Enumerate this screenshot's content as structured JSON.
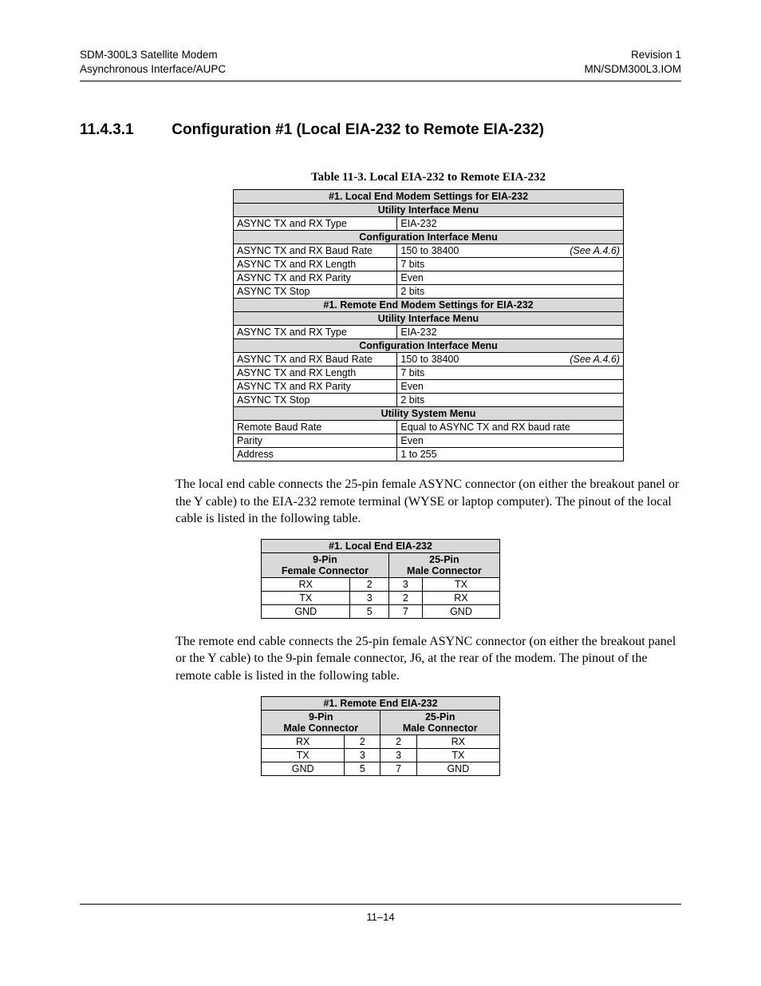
{
  "header": {
    "left1": "SDM-300L3 Satellite Modem",
    "left2": "Asynchronous Interface/AUPC",
    "right1": "Revision 1",
    "right2": "MN/SDM300L3.IOM"
  },
  "section": {
    "number": "11.4.3.1",
    "title": "Configuration #1 (Local EIA-232 to Remote EIA-232)"
  },
  "table_caption": "Table 11-3.  Local EIA-232 to Remote EIA-232",
  "settings": {
    "h1": "#1. Local End Modem Settings for EIA-232",
    "h2": "Utility Interface Menu",
    "r1a": "ASYNC TX and RX Type",
    "r1b": "EIA-232",
    "h3": "Configuration Interface Menu",
    "r2a": "ASYNC TX and RX Baud Rate",
    "r2b": "150 to 38400",
    "r2see": "(See A.4.6)",
    "r3a": "ASYNC TX and RX Length",
    "r3b": "7 bits",
    "r4a": "ASYNC TX and RX Parity",
    "r4b": "Even",
    "r5a": "ASYNC TX Stop",
    "r5b": "2 bits",
    "h4": "#1. Remote End Modem Settings for EIA-232",
    "h5": "Utility Interface Menu",
    "r6a": "ASYNC TX and RX Type",
    "r6b": "EIA-232",
    "h6": "Configuration Interface Menu",
    "r7a": "ASYNC TX and RX Baud Rate",
    "r7b": "150 to 38400",
    "r7see": "(See A.4.6)",
    "r8a": "ASYNC TX and RX Length",
    "r8b": "7 bits",
    "r9a": "ASYNC TX and RX Parity",
    "r9b": "Even",
    "r10a": "ASYNC TX Stop",
    "r10b": "2 bits",
    "h7": "Utility System Menu",
    "r11a": "Remote Baud Rate",
    "r11b": "Equal to ASYNC TX and RX baud rate",
    "r12a": "Parity",
    "r12b": "Even",
    "r13a": "Address",
    "r13b": "1 to 255"
  },
  "para1": "The local end cable connects the 25-pin female ASYNC connector (on either the breakout panel or the Y cable) to the EIA-232 remote terminal (WYSE or laptop computer). The pinout of the local cable is listed in the following table.",
  "pinout1": {
    "title": "#1. Local End EIA-232",
    "h9a": "9-Pin",
    "h9b": "Female Connector",
    "h25a": "25-Pin",
    "h25b": "Male Connector",
    "rows": [
      {
        "a": "RX",
        "b": "2",
        "c": "3",
        "d": "TX"
      },
      {
        "a": "TX",
        "b": "3",
        "c": "2",
        "d": "RX"
      },
      {
        "a": "GND",
        "b": "5",
        "c": "7",
        "d": "GND"
      }
    ]
  },
  "para2": "The remote end cable connects the 25-pin female ASYNC connector (on either the breakout panel or the Y cable) to the 9-pin female connector, J6, at the rear of the modem. The pinout of the remote cable is listed in the following table.",
  "pinout2": {
    "title": "#1. Remote End EIA-232",
    "h9a": "9-Pin",
    "h9b": "Male Connector",
    "h25a": "25-Pin",
    "h25b": "Male Connector",
    "rows": [
      {
        "a": "RX",
        "b": "2",
        "c": "2",
        "d": "RX"
      },
      {
        "a": "TX",
        "b": "3",
        "c": "3",
        "d": "TX"
      },
      {
        "a": "GND",
        "b": "5",
        "c": "7",
        "d": "GND"
      }
    ]
  },
  "footer": "11–14",
  "chart_data": {
    "type": "table",
    "tables": [
      {
        "title": "#1. Local End Modem Settings for EIA-232",
        "sections": [
          {
            "header": "Utility Interface Menu",
            "rows": [
              [
                "ASYNC TX and RX Type",
                "EIA-232"
              ]
            ]
          },
          {
            "header": "Configuration Interface Menu",
            "rows": [
              [
                "ASYNC TX and RX Baud Rate",
                "150 to 38400",
                "(See A.4.6)"
              ],
              [
                "ASYNC TX and RX Length",
                "7 bits"
              ],
              [
                "ASYNC TX and RX Parity",
                "Even"
              ],
              [
                "ASYNC TX Stop",
                "2 bits"
              ]
            ]
          }
        ]
      },
      {
        "title": "#1. Remote End Modem Settings for EIA-232",
        "sections": [
          {
            "header": "Utility Interface Menu",
            "rows": [
              [
                "ASYNC TX and RX Type",
                "EIA-232"
              ]
            ]
          },
          {
            "header": "Configuration Interface Menu",
            "rows": [
              [
                "ASYNC TX and RX Baud Rate",
                "150 to 38400",
                "(See A.4.6)"
              ],
              [
                "ASYNC TX and RX Length",
                "7 bits"
              ],
              [
                "ASYNC TX and RX Parity",
                "Even"
              ],
              [
                "ASYNC TX Stop",
                "2 bits"
              ]
            ]
          },
          {
            "header": "Utility System Menu",
            "rows": [
              [
                "Remote Baud Rate",
                "Equal to ASYNC TX and RX baud rate"
              ],
              [
                "Parity",
                "Even"
              ],
              [
                "Address",
                "1 to 255"
              ]
            ]
          }
        ]
      },
      {
        "title": "#1. Local End EIA-232",
        "columns": [
          "9-Pin Female Connector (signal)",
          "9-Pin (pin)",
          "25-Pin (pin)",
          "25-Pin Male Connector (signal)"
        ],
        "rows": [
          [
            "RX",
            "2",
            "3",
            "TX"
          ],
          [
            "TX",
            "3",
            "2",
            "RX"
          ],
          [
            "GND",
            "5",
            "7",
            "GND"
          ]
        ]
      },
      {
        "title": "#1. Remote End EIA-232",
        "columns": [
          "9-Pin Male Connector (signal)",
          "9-Pin (pin)",
          "25-Pin (pin)",
          "25-Pin Male Connector (signal)"
        ],
        "rows": [
          [
            "RX",
            "2",
            "2",
            "RX"
          ],
          [
            "TX",
            "3",
            "3",
            "TX"
          ],
          [
            "GND",
            "5",
            "7",
            "GND"
          ]
        ]
      }
    ]
  }
}
